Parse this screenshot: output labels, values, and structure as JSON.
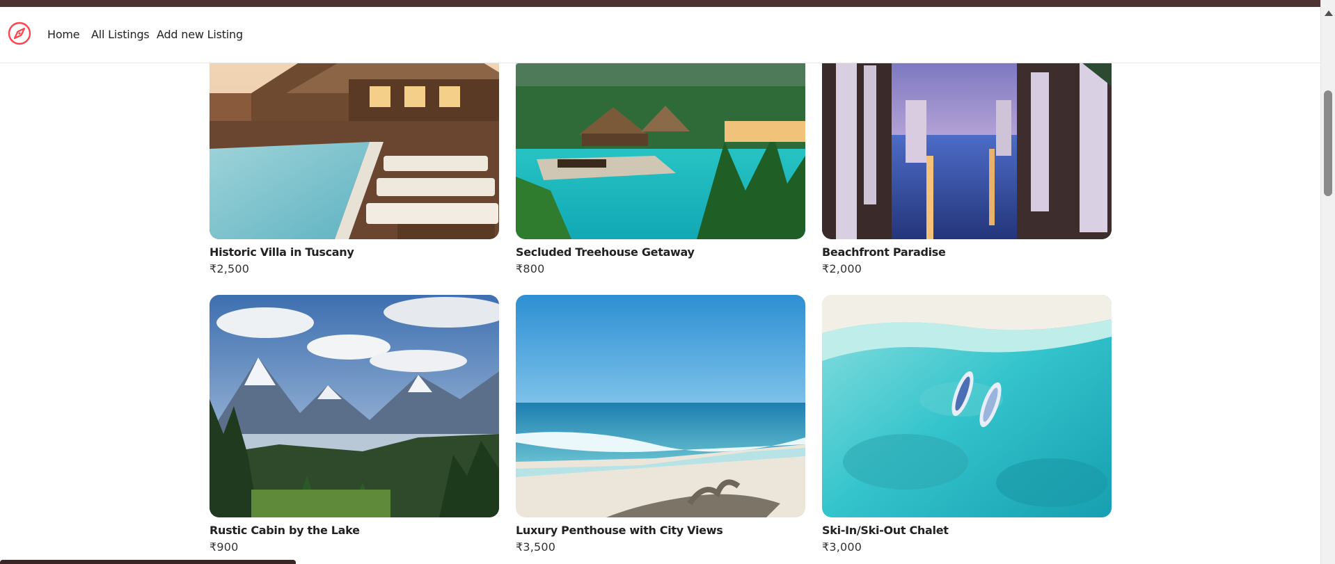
{
  "nav": {
    "logo_icon": "compass-icon",
    "brand_color": "#fe424d",
    "links": [
      "Home",
      "All Listings",
      "Add new Listing"
    ]
  },
  "listings": [
    {
      "title": "Historic Villa in Tuscany",
      "price": "₹2,500"
    },
    {
      "title": "Secluded Treehouse Getaway",
      "price": "₹800"
    },
    {
      "title": "Beachfront Paradise",
      "price": "₹2,000"
    },
    {
      "title": "Rustic Cabin by the Lake",
      "price": "₹900"
    },
    {
      "title": "Luxury Penthouse with City Views",
      "price": "₹3,500"
    },
    {
      "title": "Ski-In/Ski-Out Chalet",
      "price": "₹3,000"
    }
  ]
}
